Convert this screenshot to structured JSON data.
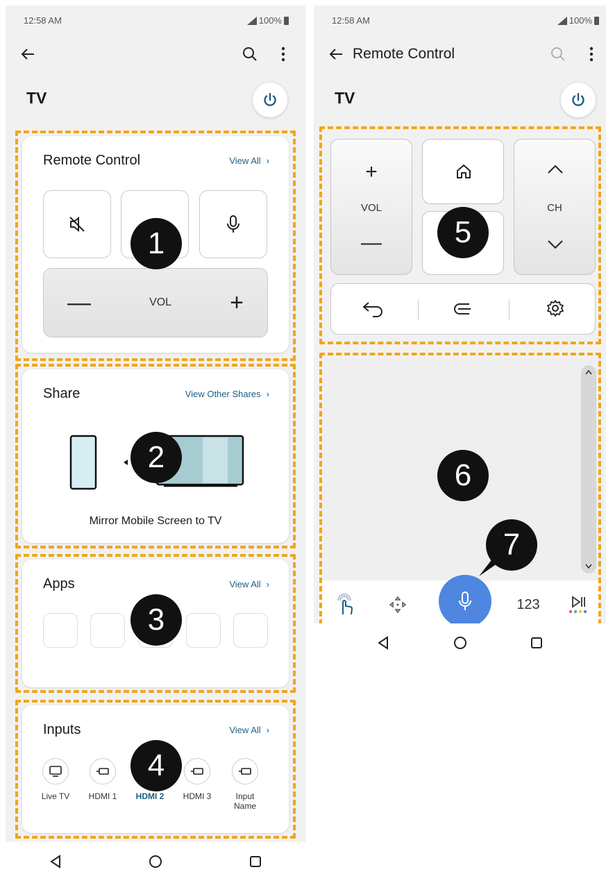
{
  "left": {
    "status": {
      "time": "12:58 AM",
      "battery": "100%"
    },
    "header": {
      "title": "TV"
    },
    "remote_control": {
      "title": "Remote Control",
      "link": "View All",
      "vol_label": "VOL",
      "minus": "—",
      "plus": "+"
    },
    "share": {
      "title": "Share",
      "link": "View Other Shares",
      "caption": "Mirror Mobile Screen to TV"
    },
    "apps": {
      "title": "Apps",
      "link": "View All"
    },
    "inputs": {
      "title": "Inputs",
      "link": "View All",
      "items": [
        {
          "label": "Live TV",
          "icon": "tv-icon"
        },
        {
          "label": "HDMI 1",
          "icon": "hdmi-icon"
        },
        {
          "label": "HDMI 2",
          "icon": "hdmi-icon"
        },
        {
          "label": "HDMI 3",
          "icon": "hdmi-icon"
        },
        {
          "label": "Input Name",
          "icon": "hdmi-icon"
        }
      ]
    },
    "badges": [
      "1",
      "2",
      "3",
      "4"
    ]
  },
  "right": {
    "status": {
      "time": "12:58 AM",
      "battery": "100%"
    },
    "header": {
      "title": "Remote Control",
      "tv": "TV"
    },
    "remote": {
      "vol_label": "VOL",
      "ch_label": "CH",
      "plus": "+",
      "minus": "—",
      "up": "^",
      "down": "v"
    },
    "tabs": {
      "numbers": "123"
    },
    "badges": [
      "5",
      "6",
      "7"
    ]
  },
  "colors": {
    "accent": "#1d5f83",
    "dashed": "#f0a61c",
    "mic": "#4f86e0",
    "badge": "#111111"
  }
}
